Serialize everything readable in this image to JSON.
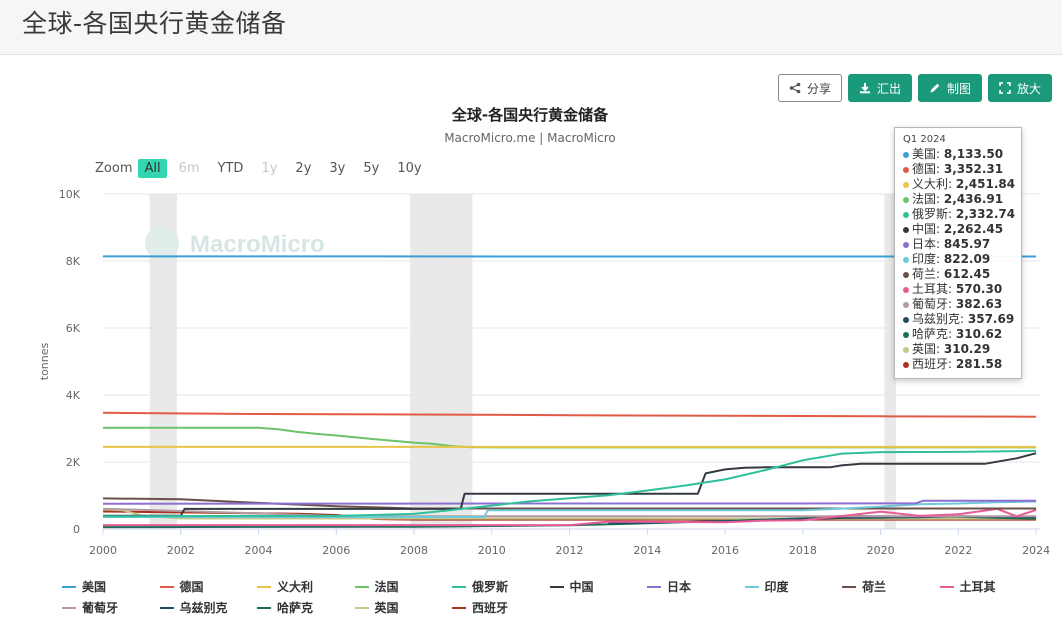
{
  "page": {
    "title": "全球-各国央行黄金储备"
  },
  "toolbar": {
    "buttons": [
      {
        "name": "share-button",
        "icon": "share-icon",
        "label": "分享",
        "style": "outline"
      },
      {
        "name": "export-button",
        "icon": "download-icon",
        "label": "汇出",
        "style": "solid"
      },
      {
        "name": "draw-button",
        "icon": "pencil-icon",
        "label": "制图",
        "style": "solid"
      },
      {
        "name": "enlarge-button",
        "icon": "expand-icon",
        "label": "放大",
        "style": "solid"
      }
    ]
  },
  "zoom": {
    "label": "Zoom",
    "buttons": [
      {
        "label": "All",
        "state": "active"
      },
      {
        "label": "6m",
        "state": "disabled"
      },
      {
        "label": "YTD",
        "state": "normal"
      },
      {
        "label": "1y",
        "state": "disabled"
      },
      {
        "label": "2y",
        "state": "normal"
      },
      {
        "label": "3y",
        "state": "normal"
      },
      {
        "label": "5y",
        "state": "normal"
      },
      {
        "label": "10y",
        "state": "normal"
      }
    ]
  },
  "watermark": "MacroMicro",
  "tooltip": {
    "header": "Q1 2024",
    "rows": [
      {
        "name": "美国",
        "value": "8,133.50",
        "color": "#3a9fd6"
      },
      {
        "name": "德国",
        "value": "3,352.31",
        "color": "#e05a45"
      },
      {
        "name": "义大利",
        "value": "2,451.84",
        "color": "#e8c547"
      },
      {
        "name": "法国",
        "value": "2,436.91",
        "color": "#6cc36a"
      },
      {
        "name": "俄罗斯",
        "value": "2,332.74",
        "color": "#2fbf9a"
      },
      {
        "name": "中国",
        "value": "2,262.45",
        "color": "#333a42"
      },
      {
        "name": "日本",
        "value": "845.97",
        "color": "#8b6fd1"
      },
      {
        "name": "印度",
        "value": "822.09",
        "color": "#6ec9d9"
      },
      {
        "name": "荷兰",
        "value": "612.45",
        "color": "#6b5048"
      },
      {
        "name": "土耳其",
        "value": "570.30",
        "color": "#e65c95"
      },
      {
        "name": "葡萄牙",
        "value": "382.63",
        "color": "#b59aa3"
      },
      {
        "name": "乌兹别克",
        "value": "357.69",
        "color": "#1f4c63"
      },
      {
        "name": "哈萨克",
        "value": "310.62",
        "color": "#1e6e5a"
      },
      {
        "name": "英国",
        "value": "310.29",
        "color": "#c4c98a"
      },
      {
        "name": "西班牙",
        "value": "281.58",
        "color": "#a8321e"
      }
    ]
  },
  "chart_data": {
    "type": "line",
    "title": "全球-各国央行黄金储备",
    "subtitle": "MacroMicro.me | MacroMicro",
    "ylabel": "tonnes",
    "xlim": [
      2000,
      2024.1
    ],
    "ylim": [
      0,
      10000
    ],
    "x_ticks": [
      2000,
      2002,
      2004,
      2006,
      2008,
      2010,
      2012,
      2014,
      2016,
      2018,
      2020,
      2022,
      2024
    ],
    "y_ticks": [
      0,
      2000,
      4000,
      6000,
      8000,
      10000
    ],
    "y_tick_labels": [
      "0",
      "2K",
      "4K",
      "6K",
      "8K",
      "10K"
    ],
    "recession_bands": [
      [
        2001.2,
        2001.9
      ],
      [
        2007.9,
        2009.5
      ],
      [
        2020.1,
        2020.4
      ]
    ],
    "grid": "horizontal",
    "legend_position": "bottom",
    "series": [
      {
        "name": "美国",
        "color": "#3a9fd6",
        "points": [
          [
            2000,
            8137
          ],
          [
            2024,
            8133.5
          ]
        ]
      },
      {
        "name": "德国",
        "color": "#e05a45",
        "points": [
          [
            2000,
            3469
          ],
          [
            2004,
            3433
          ],
          [
            2008,
            3417
          ],
          [
            2012,
            3396
          ],
          [
            2016,
            3378
          ],
          [
            2020,
            3364
          ],
          [
            2024,
            3352.31
          ]
        ]
      },
      {
        "name": "义大利",
        "color": "#e8c547",
        "points": [
          [
            2000,
            2452
          ],
          [
            2024,
            2451.84
          ]
        ]
      },
      {
        "name": "法国",
        "color": "#6cc36a",
        "points": [
          [
            2000,
            3025
          ],
          [
            2004,
            3025
          ],
          [
            2004.5,
            2980
          ],
          [
            2005,
            2900
          ],
          [
            2005.5,
            2840
          ],
          [
            2006,
            2790
          ],
          [
            2007,
            2680
          ],
          [
            2008,
            2580
          ],
          [
            2008.5,
            2540
          ],
          [
            2009,
            2470
          ],
          [
            2009.5,
            2440
          ],
          [
            2012,
            2435
          ],
          [
            2024,
            2436.91
          ]
        ]
      },
      {
        "name": "俄罗斯",
        "color": "#2fbf9a",
        "points": [
          [
            2000,
            380
          ],
          [
            2004,
            390
          ],
          [
            2006,
            390
          ],
          [
            2008,
            450
          ],
          [
            2009,
            570
          ],
          [
            2010,
            700
          ],
          [
            2011,
            830
          ],
          [
            2012,
            920
          ],
          [
            2013,
            1010
          ],
          [
            2014,
            1150
          ],
          [
            2015,
            1300
          ],
          [
            2016,
            1480
          ],
          [
            2017,
            1750
          ],
          [
            2018,
            2050
          ],
          [
            2019,
            2250
          ],
          [
            2020,
            2295
          ],
          [
            2022,
            2300
          ],
          [
            2024,
            2332.74
          ]
        ]
      },
      {
        "name": "中国",
        "color": "#333a42",
        "points": [
          [
            2000,
            395
          ],
          [
            2002,
            395
          ],
          [
            2002.1,
            600
          ],
          [
            2009.2,
            600
          ],
          [
            2009.3,
            1054
          ],
          [
            2015.3,
            1054
          ],
          [
            2015.5,
            1660
          ],
          [
            2016,
            1780
          ],
          [
            2016.5,
            1830
          ],
          [
            2017,
            1842
          ],
          [
            2018.7,
            1842
          ],
          [
            2019,
            1900
          ],
          [
            2019.5,
            1948
          ],
          [
            2022.7,
            1948
          ],
          [
            2023,
            2010
          ],
          [
            2023.5,
            2110
          ],
          [
            2024,
            2262.45
          ]
        ]
      },
      {
        "name": "日本",
        "color": "#8b6fd1",
        "points": [
          [
            2000,
            754
          ],
          [
            2020.9,
            765
          ],
          [
            2021.1,
            845
          ],
          [
            2024,
            845.97
          ]
        ]
      },
      {
        "name": "印度",
        "color": "#6ec9d9",
        "points": [
          [
            2000,
            358
          ],
          [
            2009.8,
            358
          ],
          [
            2009.9,
            558
          ],
          [
            2018,
            560
          ],
          [
            2019,
            610
          ],
          [
            2020,
            670
          ],
          [
            2021,
            740
          ],
          [
            2022,
            760
          ],
          [
            2023,
            800
          ],
          [
            2024,
            822.09
          ]
        ]
      },
      {
        "name": "荷兰",
        "color": "#6b5048",
        "points": [
          [
            2000,
            912
          ],
          [
            2002,
            888
          ],
          [
            2004,
            778
          ],
          [
            2006,
            680
          ],
          [
            2008,
            612
          ],
          [
            2024,
            612.45
          ]
        ]
      },
      {
        "name": "土耳其",
        "color": "#e65c95",
        "points": [
          [
            2000,
            116
          ],
          [
            2012,
            116
          ],
          [
            2013,
            220
          ],
          [
            2016,
            200
          ],
          [
            2017,
            250
          ],
          [
            2018,
            260
          ],
          [
            2019,
            385
          ],
          [
            2020,
            520
          ],
          [
            2021,
            390
          ],
          [
            2022,
            440
          ],
          [
            2023,
            600
          ],
          [
            2023.5,
            380
          ],
          [
            2024,
            570.3
          ]
        ]
      },
      {
        "name": "葡萄牙",
        "color": "#b59aa3",
        "points": [
          [
            2000,
            607
          ],
          [
            2004,
            470
          ],
          [
            2006,
            383
          ],
          [
            2024,
            382.63
          ]
        ]
      },
      {
        "name": "乌兹别克",
        "color": "#1f4c63",
        "points": [
          [
            2013,
            170
          ],
          [
            2016,
            230
          ],
          [
            2018,
            290
          ],
          [
            2019,
            330
          ],
          [
            2020,
            340
          ],
          [
            2021,
            350
          ],
          [
            2022,
            380
          ],
          [
            2023,
            370
          ],
          [
            2024,
            357.69
          ]
        ]
      },
      {
        "name": "哈萨克",
        "color": "#1e6e5a",
        "points": [
          [
            2000,
            56
          ],
          [
            2008,
            70
          ],
          [
            2012,
            110
          ],
          [
            2014,
            170
          ],
          [
            2016,
            240
          ],
          [
            2018,
            320
          ],
          [
            2019,
            385
          ],
          [
            2020,
            380
          ],
          [
            2022,
            370
          ],
          [
            2023,
            330
          ],
          [
            2024,
            310.62
          ]
        ]
      },
      {
        "name": "英国",
        "color": "#c4c98a",
        "points": [
          [
            2000,
            590
          ],
          [
            2000.5,
            560
          ],
          [
            2001,
            400
          ],
          [
            2002,
            313
          ],
          [
            2024,
            310.29
          ]
        ]
      },
      {
        "name": "西班牙",
        "color": "#a8321e",
        "points": [
          [
            2000,
            523
          ],
          [
            2005,
            457
          ],
          [
            2006,
            418
          ],
          [
            2007,
            300
          ],
          [
            2008,
            282
          ],
          [
            2024,
            281.58
          ]
        ]
      }
    ]
  }
}
